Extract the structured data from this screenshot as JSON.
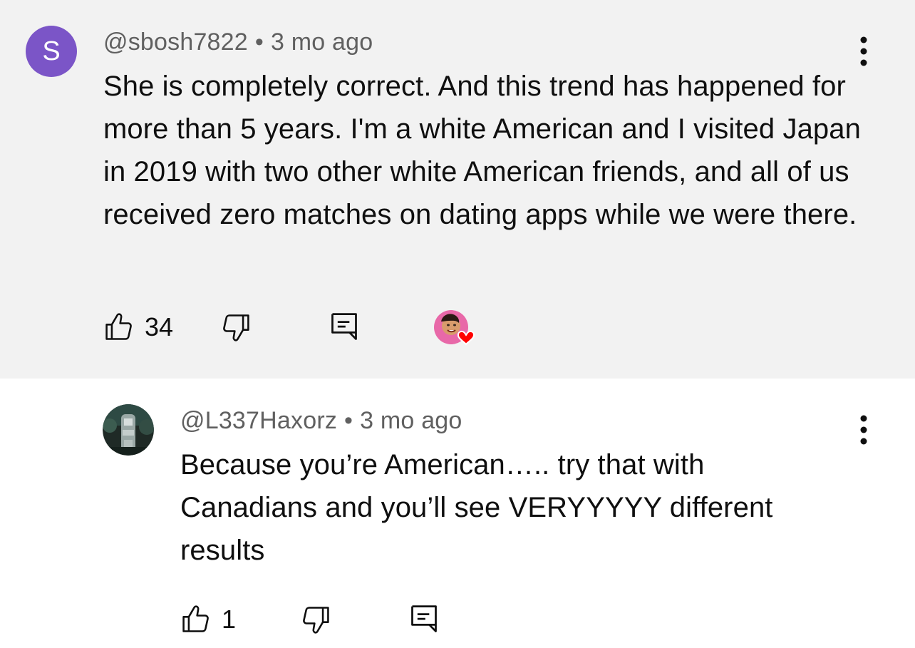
{
  "comments": [
    {
      "avatar_letter": "S",
      "avatar_color": "#7b55c7",
      "handle": "@sbosh7822",
      "separator": "•",
      "time": "3 mo ago",
      "text": "She is completely correct. And this trend has happened for more than 5 years. I'm a white American and I visited Japan in 2019 with two other white American friends, and all of us received zero matches on dating apps while we were there.",
      "likes": "34",
      "creator_hearted": true,
      "background": "#f2f2f2"
    },
    {
      "handle": "@L337Haxorz",
      "separator": "•",
      "time": "3 mo ago",
      "text": "Because you’re American….. try that with Canadians and you’ll see VERYYYYY different results",
      "likes": "1",
      "creator_hearted": false,
      "background": "#ffffff"
    }
  ],
  "icons": {
    "like": "thumbs-up-icon",
    "dislike": "thumbs-down-icon",
    "reply": "reply-comment-icon",
    "more": "more-vertical-icon",
    "heart": "heart-icon"
  },
  "colors": {
    "heart": "#ff0000",
    "meta_text": "#606060",
    "body_text": "#0f0f0f"
  }
}
